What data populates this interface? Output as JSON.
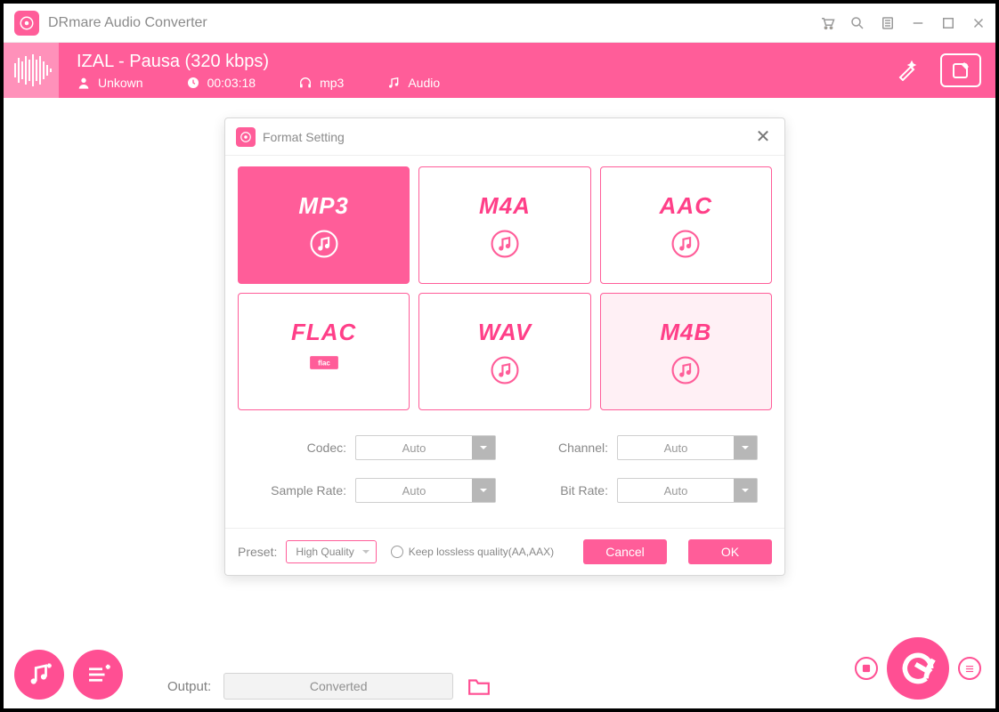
{
  "app": {
    "title": "DRmare Audio Converter"
  },
  "track": {
    "title": "IZAL - Pausa (320  kbps)",
    "artist": "Unkown",
    "duration": "00:03:18",
    "format": "mp3",
    "type": "Audio"
  },
  "dialog": {
    "title": "Format Setting",
    "formats": [
      "MP3",
      "M4A",
      "AAC",
      "FLAC",
      "WAV",
      "M4B"
    ],
    "selected": "MP3",
    "hover": "M4B",
    "options": {
      "codec": {
        "label": "Codec:",
        "value": "Auto"
      },
      "channel": {
        "label": "Channel:",
        "value": "Auto"
      },
      "sample": {
        "label": "Sample Rate:",
        "value": "Auto"
      },
      "bitrate": {
        "label": "Bit Rate:",
        "value": "Auto"
      }
    },
    "preset_label": "Preset:",
    "preset_value": "High Quality",
    "lossless_label": "Keep lossless quality(AA,AAX)",
    "cancel": "Cancel",
    "ok": "OK"
  },
  "bottom": {
    "output_label": "Output:",
    "output_value": "Converted"
  }
}
